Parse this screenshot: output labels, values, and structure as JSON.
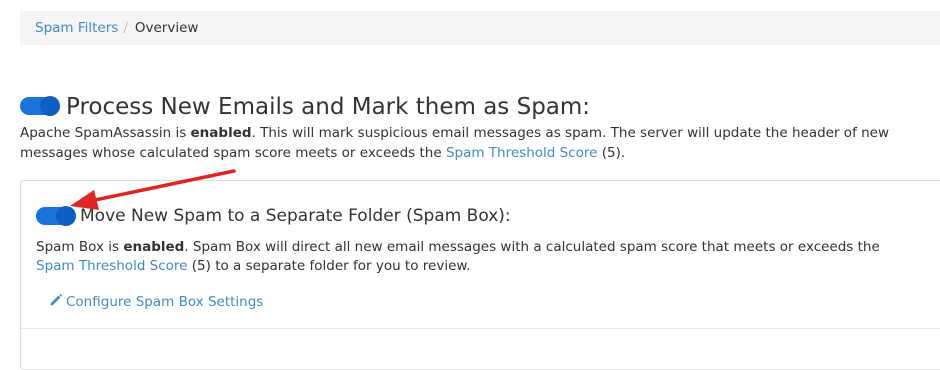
{
  "breadcrumb": {
    "items": [
      {
        "label": "Spam Filters"
      },
      {
        "label": "Overview"
      }
    ],
    "separator": "/"
  },
  "process_section": {
    "toggle_on": true,
    "heading": "Process New Emails and Mark them as Spam:",
    "desc_part1": "Apache SpamAssassin is ",
    "desc_status": "enabled",
    "desc_part2": ". This will mark suspicious email messages as spam. The server will update the header of new messages whose calculated spam score meets or exceeds the ",
    "desc_link": "Spam Threshold Score",
    "desc_part3": " (5)."
  },
  "spam_box_section": {
    "toggle_on": true,
    "heading": "Move New Spam to a Separate Folder (Spam Box):",
    "desc_part1": "Spam Box is ",
    "desc_status": "enabled",
    "desc_part2": ". Spam Box will direct all new email messages with a calculated spam score that meets or exceeds the ",
    "desc_link": "Spam Threshold Score",
    "desc_part3": " (5) to a separate folder for you to review.",
    "configure_link": "Configure Spam Box Settings"
  },
  "colors": {
    "accent": "#428bca",
    "toggle_on": "#1a73d9",
    "annotation_arrow": "#e02424"
  },
  "icons": {
    "configure": "pencil-icon"
  }
}
